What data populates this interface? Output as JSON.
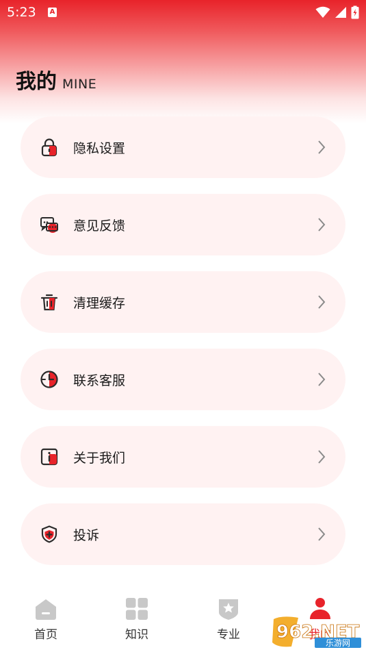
{
  "status_bar": {
    "time": "5:23",
    "notification_badge": "A"
  },
  "header": {
    "title": "我的",
    "subtitle": "MINE"
  },
  "menu": {
    "items": [
      {
        "label": "隐私设置",
        "icon": "lock-icon"
      },
      {
        "label": "意见反馈",
        "icon": "feedback-chat-icon"
      },
      {
        "label": "清理缓存",
        "icon": "trash-icon"
      },
      {
        "label": "联系客服",
        "icon": "customer-service-icon"
      },
      {
        "label": "关于我们",
        "icon": "about-info-icon"
      },
      {
        "label": "投诉",
        "icon": "shield-complaint-icon"
      }
    ]
  },
  "bottom_nav": {
    "items": [
      {
        "label": "首页",
        "icon": "home-icon",
        "active": false
      },
      {
        "label": "知识",
        "icon": "grid-icon",
        "active": false
      },
      {
        "label": "专业",
        "icon": "star-badge-icon",
        "active": false
      },
      {
        "label": "我的",
        "icon": "user-icon",
        "active": true
      }
    ]
  },
  "watermark": {
    "text_main": "962.NET",
    "text_sub": "乐游网"
  },
  "colors": {
    "accent": "#e8232a",
    "card_bg": "#fff2f2",
    "icon_dark": "#2b2b2b",
    "nav_inactive": "#c8c8c8"
  }
}
